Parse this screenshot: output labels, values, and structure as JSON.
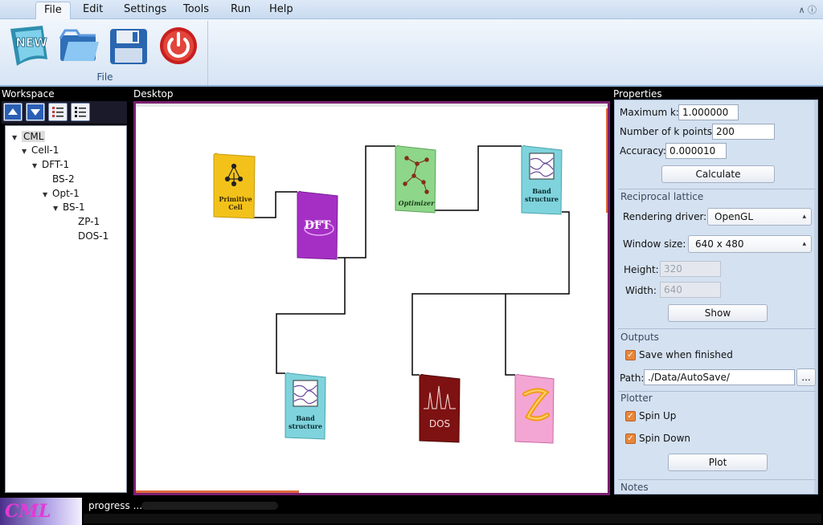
{
  "menu": {
    "items": [
      {
        "label": "File",
        "active": true
      },
      {
        "label": "Edit",
        "active": false
      },
      {
        "label": "Settings",
        "active": false
      },
      {
        "label": "Tools",
        "active": false
      },
      {
        "label": "Run",
        "active": false
      },
      {
        "label": "Help",
        "active": false
      }
    ],
    "right_glyphs": "∧ ⓘ"
  },
  "ribbon": {
    "group_label": "File",
    "buttons": [
      {
        "name": "new",
        "icon": "new-icon",
        "badge_text": "NEW"
      },
      {
        "name": "open",
        "icon": "folder-icon"
      },
      {
        "name": "save",
        "icon": "floppy-disk-icon"
      },
      {
        "name": "exit",
        "icon": "power-icon"
      }
    ]
  },
  "workspace": {
    "title": "Workspace",
    "toolbar": [
      "arrow-up-icon",
      "arrow-down-icon",
      "expand-list-icon",
      "collapse-list-icon"
    ],
    "tree": [
      {
        "label": "CML",
        "depth": 0,
        "expanded": true,
        "selected": true
      },
      {
        "label": "Cell-1",
        "depth": 1,
        "expanded": true
      },
      {
        "label": "DFT-1",
        "depth": 2,
        "expanded": true
      },
      {
        "label": "BS-2",
        "depth": 3,
        "expanded": false
      },
      {
        "label": "Opt-1",
        "depth": 3,
        "expanded": true
      },
      {
        "label": "BS-1",
        "depth": 4,
        "expanded": true
      },
      {
        "label": "ZP-1",
        "depth": 5,
        "expanded": false
      },
      {
        "label": "DOS-1",
        "depth": 5,
        "expanded": false
      }
    ]
  },
  "desktop": {
    "title": "Desktop",
    "nodes": [
      {
        "id": "primitive-cell",
        "label_lines": [
          "Primitive",
          "Cell"
        ],
        "color": "#f2c21b"
      },
      {
        "id": "dft",
        "label_lines": [
          "DFT"
        ],
        "color": "#a52fc4"
      },
      {
        "id": "optimizer",
        "label_lines": [
          "Optimizer"
        ],
        "color": "#8ed68a"
      },
      {
        "id": "band-structure-1",
        "label_lines": [
          "Band",
          "structure"
        ],
        "color": "#7fd3dc"
      },
      {
        "id": "band-structure-2",
        "label_lines": [
          "Band",
          "structure"
        ],
        "color": "#7fd3dc"
      },
      {
        "id": "dos",
        "label_lines": [
          "DOS"
        ],
        "color": "#7e1111"
      },
      {
        "id": "zp",
        "label_lines": [],
        "color": "#f3a6d3"
      }
    ]
  },
  "properties": {
    "title": "Properties",
    "max_k_label": "Maximum k:",
    "max_k_value": "1.000000",
    "num_k_label": "Number of k points:",
    "num_k_value": "200",
    "accuracy_label": "Accuracy:",
    "accuracy_value": "0.000010",
    "calculate_label": "Calculate",
    "reciprocal_section": "Reciprocal lattice",
    "rendering_label": "Rendering driver:",
    "rendering_value": "OpenGL",
    "window_size_label": "Window size:",
    "window_size_value": "640 x 480",
    "height_label": "Height:",
    "height_value": "320",
    "width_label": "Width:",
    "width_value": "640",
    "show_label": "Show",
    "outputs_section": "Outputs",
    "save_when_finished_label": "Save when finished",
    "save_when_finished_checked": true,
    "path_label": "Path:",
    "path_value": "./Data/AutoSave/",
    "browse_label": "...",
    "plotter_section": "Plotter",
    "spin_up_label": "Spin Up",
    "spin_up_checked": true,
    "spin_down_label": "Spin Down",
    "spin_down_checked": true,
    "plot_label": "Plot",
    "notes_section": "Notes"
  },
  "status": {
    "logo_text": "CML",
    "progress_label": "progress ...",
    "progress_fraction": 0
  }
}
